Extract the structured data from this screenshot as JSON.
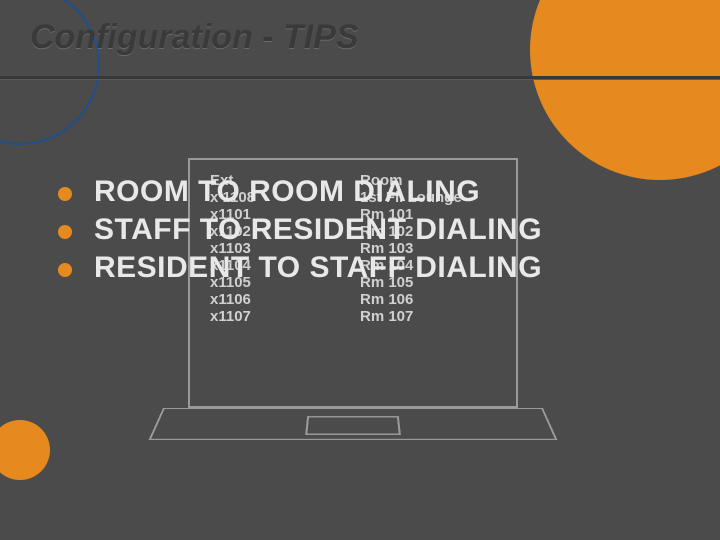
{
  "title": "Configuration - TIPS",
  "bullets": [
    "ROOM TO ROOM DIALING",
    "STAFF TO RESIDENT DIALING",
    "RESIDENT TO STAFF DIALING"
  ],
  "table": {
    "headers": {
      "ext": "Ext",
      "room": "Room"
    },
    "rows": [
      {
        "ext": "x 1108",
        "room": "1st Fl. Lounge"
      },
      {
        "ext": "x1101",
        "room": "Rm 101"
      },
      {
        "ext": "x1102",
        "room": "Rm 102"
      },
      {
        "ext": "x1103",
        "room": "Rm 103"
      },
      {
        "ext": "x1104",
        "room": "Rm 104"
      },
      {
        "ext": "x1105",
        "room": "Rm 105"
      },
      {
        "ext": "x1106",
        "room": "Rm 106"
      },
      {
        "ext": "x1107",
        "room": "Rm 107"
      }
    ]
  },
  "colors": {
    "accent": "#e68a1f",
    "bg": "#4b4b4b",
    "text_light": "#e8e8e8",
    "text_dim": "#d0d0d0"
  }
}
